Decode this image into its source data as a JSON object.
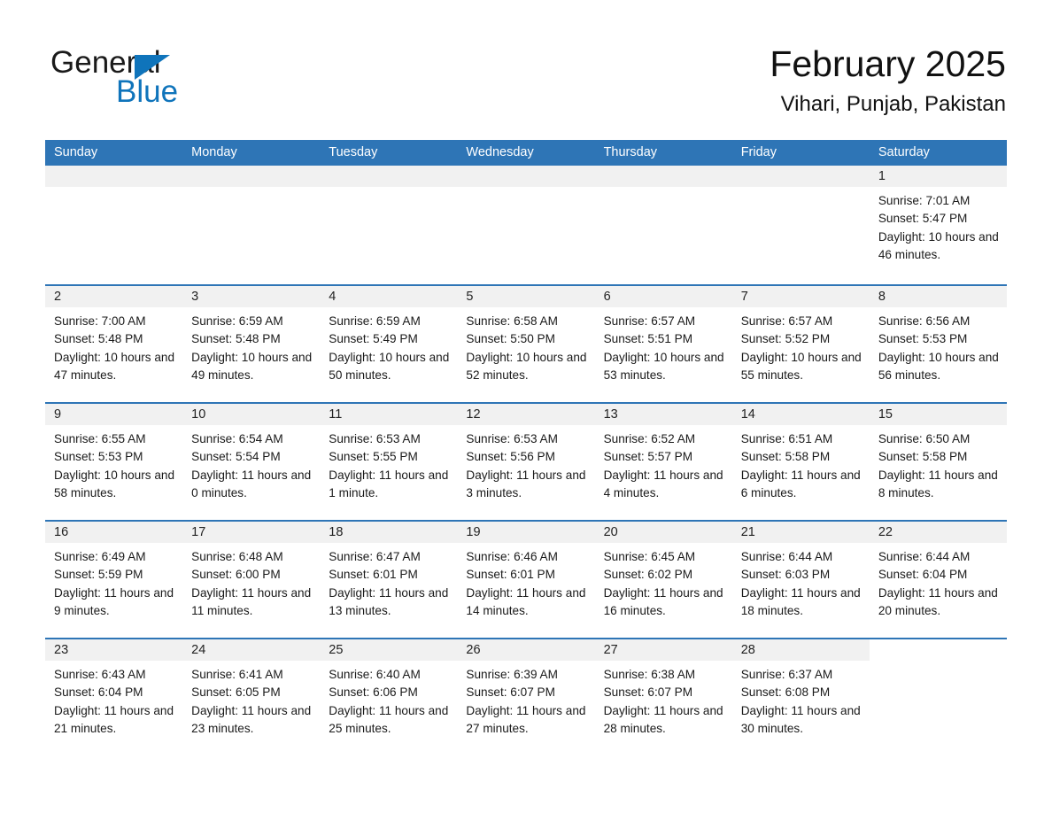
{
  "logo": {
    "word_one": "General",
    "word_two": "Blue"
  },
  "header": {
    "title": "February 2025",
    "location": "Vihari, Punjab, Pakistan"
  },
  "colors": {
    "header_blue": "#2e75b6",
    "logo_blue": "#0f74bb",
    "day_band": "#f1f1f1"
  },
  "weekdays": [
    "Sunday",
    "Monday",
    "Tuesday",
    "Wednesday",
    "Thursday",
    "Friday",
    "Saturday"
  ],
  "weeks": [
    [
      {
        "day": "",
        "blank": true
      },
      {
        "day": "",
        "blank": true
      },
      {
        "day": "",
        "blank": true
      },
      {
        "day": "",
        "blank": true
      },
      {
        "day": "",
        "blank": true
      },
      {
        "day": "",
        "blank": true
      },
      {
        "day": "1",
        "sunrise": "Sunrise: 7:01 AM",
        "sunset": "Sunset: 5:47 PM",
        "daylight": "Daylight: 10 hours and 46 minutes."
      }
    ],
    [
      {
        "day": "2",
        "sunrise": "Sunrise: 7:00 AM",
        "sunset": "Sunset: 5:48 PM",
        "daylight": "Daylight: 10 hours and 47 minutes."
      },
      {
        "day": "3",
        "sunrise": "Sunrise: 6:59 AM",
        "sunset": "Sunset: 5:48 PM",
        "daylight": "Daylight: 10 hours and 49 minutes."
      },
      {
        "day": "4",
        "sunrise": "Sunrise: 6:59 AM",
        "sunset": "Sunset: 5:49 PM",
        "daylight": "Daylight: 10 hours and 50 minutes."
      },
      {
        "day": "5",
        "sunrise": "Sunrise: 6:58 AM",
        "sunset": "Sunset: 5:50 PM",
        "daylight": "Daylight: 10 hours and 52 minutes."
      },
      {
        "day": "6",
        "sunrise": "Sunrise: 6:57 AM",
        "sunset": "Sunset: 5:51 PM",
        "daylight": "Daylight: 10 hours and 53 minutes."
      },
      {
        "day": "7",
        "sunrise": "Sunrise: 6:57 AM",
        "sunset": "Sunset: 5:52 PM",
        "daylight": "Daylight: 10 hours and 55 minutes."
      },
      {
        "day": "8",
        "sunrise": "Sunrise: 6:56 AM",
        "sunset": "Sunset: 5:53 PM",
        "daylight": "Daylight: 10 hours and 56 minutes."
      }
    ],
    [
      {
        "day": "9",
        "sunrise": "Sunrise: 6:55 AM",
        "sunset": "Sunset: 5:53 PM",
        "daylight": "Daylight: 10 hours and 58 minutes."
      },
      {
        "day": "10",
        "sunrise": "Sunrise: 6:54 AM",
        "sunset": "Sunset: 5:54 PM",
        "daylight": "Daylight: 11 hours and 0 minutes."
      },
      {
        "day": "11",
        "sunrise": "Sunrise: 6:53 AM",
        "sunset": "Sunset: 5:55 PM",
        "daylight": "Daylight: 11 hours and 1 minute."
      },
      {
        "day": "12",
        "sunrise": "Sunrise: 6:53 AM",
        "sunset": "Sunset: 5:56 PM",
        "daylight": "Daylight: 11 hours and 3 minutes."
      },
      {
        "day": "13",
        "sunrise": "Sunrise: 6:52 AM",
        "sunset": "Sunset: 5:57 PM",
        "daylight": "Daylight: 11 hours and 4 minutes."
      },
      {
        "day": "14",
        "sunrise": "Sunrise: 6:51 AM",
        "sunset": "Sunset: 5:58 PM",
        "daylight": "Daylight: 11 hours and 6 minutes."
      },
      {
        "day": "15",
        "sunrise": "Sunrise: 6:50 AM",
        "sunset": "Sunset: 5:58 PM",
        "daylight": "Daylight: 11 hours and 8 minutes."
      }
    ],
    [
      {
        "day": "16",
        "sunrise": "Sunrise: 6:49 AM",
        "sunset": "Sunset: 5:59 PM",
        "daylight": "Daylight: 11 hours and 9 minutes."
      },
      {
        "day": "17",
        "sunrise": "Sunrise: 6:48 AM",
        "sunset": "Sunset: 6:00 PM",
        "daylight": "Daylight: 11 hours and 11 minutes."
      },
      {
        "day": "18",
        "sunrise": "Sunrise: 6:47 AM",
        "sunset": "Sunset: 6:01 PM",
        "daylight": "Daylight: 11 hours and 13 minutes."
      },
      {
        "day": "19",
        "sunrise": "Sunrise: 6:46 AM",
        "sunset": "Sunset: 6:01 PM",
        "daylight": "Daylight: 11 hours and 14 minutes."
      },
      {
        "day": "20",
        "sunrise": "Sunrise: 6:45 AM",
        "sunset": "Sunset: 6:02 PM",
        "daylight": "Daylight: 11 hours and 16 minutes."
      },
      {
        "day": "21",
        "sunrise": "Sunrise: 6:44 AM",
        "sunset": "Sunset: 6:03 PM",
        "daylight": "Daylight: 11 hours and 18 minutes."
      },
      {
        "day": "22",
        "sunrise": "Sunrise: 6:44 AM",
        "sunset": "Sunset: 6:04 PM",
        "daylight": "Daylight: 11 hours and 20 minutes."
      }
    ],
    [
      {
        "day": "23",
        "sunrise": "Sunrise: 6:43 AM",
        "sunset": "Sunset: 6:04 PM",
        "daylight": "Daylight: 11 hours and 21 minutes."
      },
      {
        "day": "24",
        "sunrise": "Sunrise: 6:41 AM",
        "sunset": "Sunset: 6:05 PM",
        "daylight": "Daylight: 11 hours and 23 minutes."
      },
      {
        "day": "25",
        "sunrise": "Sunrise: 6:40 AM",
        "sunset": "Sunset: 6:06 PM",
        "daylight": "Daylight: 11 hours and 25 minutes."
      },
      {
        "day": "26",
        "sunrise": "Sunrise: 6:39 AM",
        "sunset": "Sunset: 6:07 PM",
        "daylight": "Daylight: 11 hours and 27 minutes."
      },
      {
        "day": "27",
        "sunrise": "Sunrise: 6:38 AM",
        "sunset": "Sunset: 6:07 PM",
        "daylight": "Daylight: 11 hours and 28 minutes."
      },
      {
        "day": "28",
        "sunrise": "Sunrise: 6:37 AM",
        "sunset": "Sunset: 6:08 PM",
        "daylight": "Daylight: 11 hours and 30 minutes."
      },
      {
        "day": "",
        "empty": true
      }
    ]
  ]
}
